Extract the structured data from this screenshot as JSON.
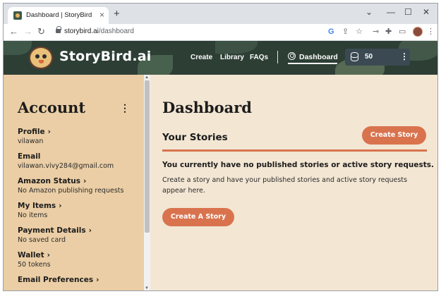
{
  "browser": {
    "tab": {
      "title": "Dashboard | StoryBird",
      "close": "×"
    },
    "new_tab": "+",
    "window_controls": {
      "dropdown": "⌄",
      "minimize": "—",
      "maximize": "☐",
      "close": "✕"
    },
    "nav": {
      "back": "←",
      "forward": "→",
      "reload": "↻"
    },
    "address": {
      "host": "storybird.ai",
      "path": "/dashboard"
    },
    "toolbar_icons": [
      "google-icon",
      "share-icon",
      "star-icon",
      "key-icon",
      "puzzle-icon",
      "sidepanel-icon",
      "avatar",
      "kebab-icon"
    ],
    "toolbar_glyphs": {
      "google": "G",
      "share": "⇪",
      "star": "☆",
      "key": "⊸",
      "puzzle": "✚",
      "sidepanel": "▭",
      "kebab": "⋮"
    }
  },
  "header": {
    "logo_text": "StoryBird.ai",
    "nav_links": [
      "Create",
      "Library",
      "FAQs"
    ],
    "dashboard_label": "Dashboard",
    "token_count": "50",
    "token_menu": "⋮",
    "colors": {
      "bg": "#2d3e35",
      "accent": "#d9734e"
    }
  },
  "sidebar": {
    "title": "Account",
    "menu": "⋮",
    "items": [
      {
        "label": "Profile",
        "chevron": "›",
        "value": "vilawan"
      },
      {
        "label": "Email",
        "chevron": "",
        "value": "vilawan.vivy284@gmail.com"
      },
      {
        "label": "Amazon Status",
        "chevron": "›",
        "value": "No Amazon publishing requests"
      },
      {
        "label": "My Items",
        "chevron": "›",
        "value": "No items"
      },
      {
        "label": "Payment Details",
        "chevron": "›",
        "value": "No saved card"
      },
      {
        "label": "Wallet",
        "chevron": "›",
        "value": "50 tokens"
      },
      {
        "label": "Email Preferences",
        "chevron": "›",
        "value": ""
      }
    ]
  },
  "main": {
    "title": "Dashboard",
    "section_title": "Your Stories",
    "create_story_button": "Create Story",
    "empty_message": "You currently have no published stories or active story requests.",
    "empty_sub": "Create a story and have your published stories and active story requests appear here.",
    "create_a_story_button": "Create A Story"
  }
}
